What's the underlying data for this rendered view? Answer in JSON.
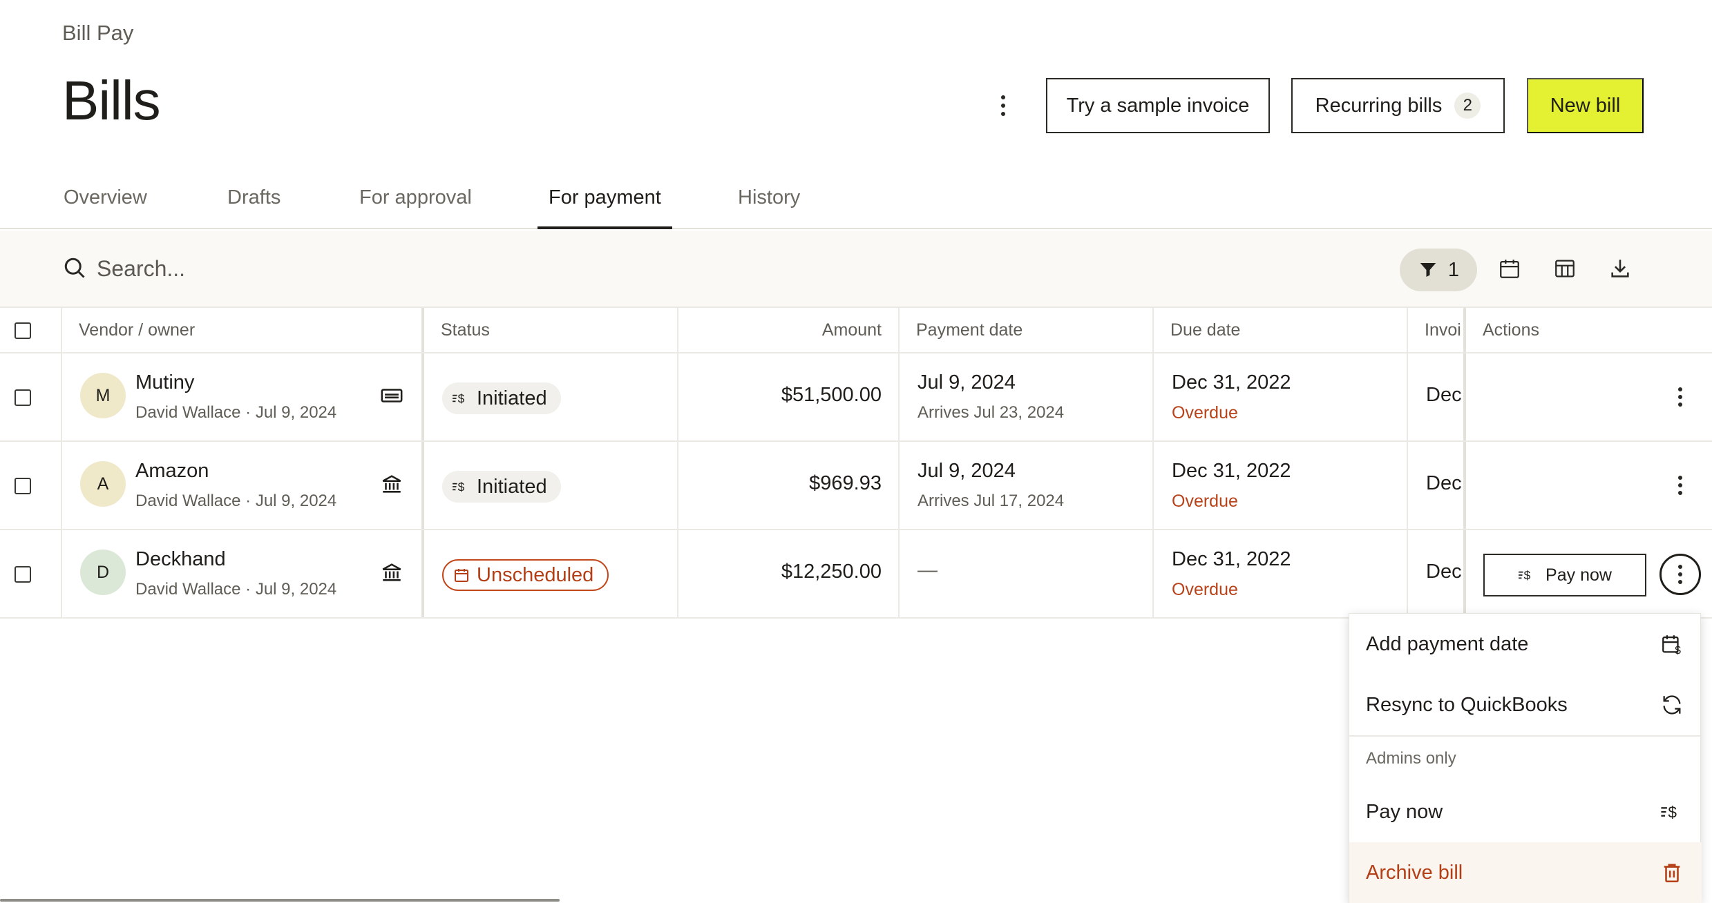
{
  "header": {
    "breadcrumb": "Bill Pay",
    "title": "Bills",
    "sample_invoice_label": "Try a sample invoice",
    "recurring_label": "Recurring bills",
    "recurring_count": "2",
    "new_bill_label": "New bill"
  },
  "tabs": [
    {
      "label": "Overview"
    },
    {
      "label": "Drafts"
    },
    {
      "label": "For approval"
    },
    {
      "label": "For payment",
      "active": true
    },
    {
      "label": "History"
    }
  ],
  "toolbar": {
    "search_placeholder": "Search...",
    "filter_count": "1"
  },
  "table": {
    "columns": {
      "vendor": "Vendor / owner",
      "status": "Status",
      "amount": "Amount",
      "payment_date": "Payment date",
      "due_date": "Due date",
      "invoice": "Invoice",
      "actions": "Actions"
    },
    "rows": [
      {
        "initial": "M",
        "vendor": "Mutiny",
        "owner_line": "David Wallace · Jul 9, 2024",
        "method_icon": "card-icon",
        "status": "Initiated",
        "amount": "$51,500.00",
        "payment_date": "Jul 9, 2024",
        "arrives": "Arrives Jul 23, 2024",
        "due_date": "Dec 31, 2022",
        "due_status": "Overdue",
        "invoice": "Dec"
      },
      {
        "initial": "A",
        "vendor": "Amazon",
        "owner_line": "David Wallace · Jul 9, 2024",
        "method_icon": "bank-icon",
        "status": "Initiated",
        "amount": "$969.93",
        "payment_date": "Jul 9, 2024",
        "arrives": "Arrives Jul 17, 2024",
        "due_date": "Dec 31, 2022",
        "due_status": "Overdue",
        "invoice": "Dec"
      },
      {
        "initial": "D",
        "vendor": "Deckhand",
        "owner_line": "David Wallace · Jul 9, 2024",
        "method_icon": "bank-icon",
        "status": "Unscheduled",
        "amount": "$12,250.00",
        "payment_date": "—",
        "due_date": "Dec 31, 2022",
        "due_status": "Overdue",
        "invoice": "Dec",
        "action_label": "Pay now"
      }
    ]
  },
  "menu": {
    "add_payment_date": "Add payment date",
    "resync": "Resync to QuickBooks",
    "section_label": "Admins only",
    "pay_now": "Pay now",
    "archive": "Archive bill"
  },
  "colors": {
    "accent": "#e4f132",
    "overdue": "#b8431a",
    "unscheduled": "#c2471a"
  }
}
